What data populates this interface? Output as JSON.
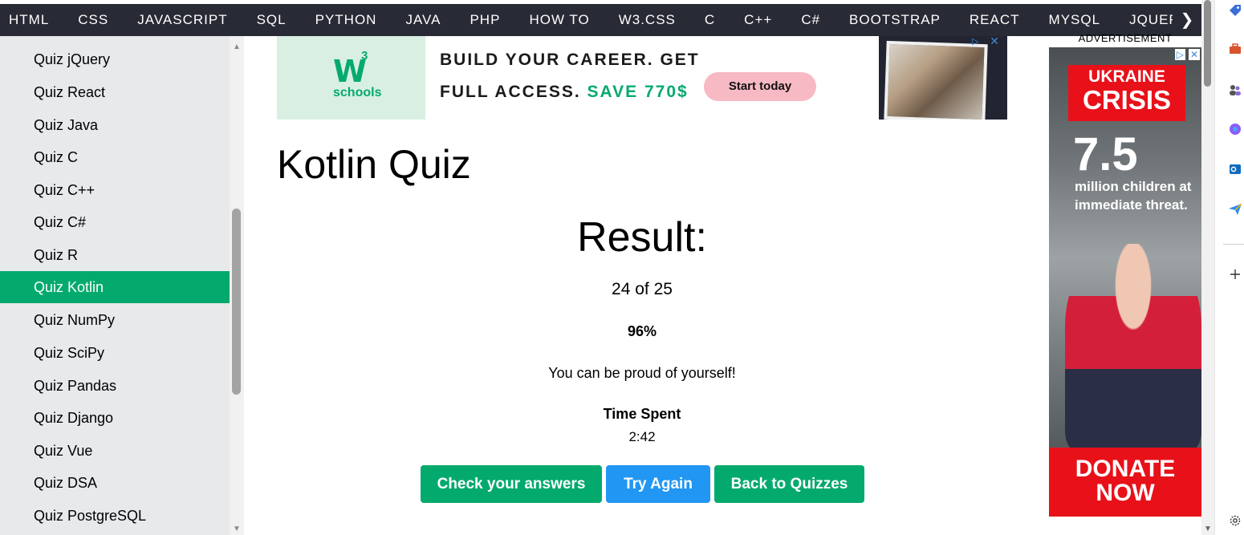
{
  "topnav": {
    "items": [
      "HTML",
      "CSS",
      "JAVASCRIPT",
      "SQL",
      "PYTHON",
      "JAVA",
      "PHP",
      "HOW TO",
      "W3.CSS",
      "C",
      "C++",
      "C#",
      "BOOTSTRAP",
      "REACT",
      "MYSQL",
      "JQUERY"
    ],
    "next_glyph": "❯"
  },
  "sidebar": {
    "items": [
      {
        "label": "Quiz jQuery"
      },
      {
        "label": "Quiz React"
      },
      {
        "label": "Quiz Java"
      },
      {
        "label": "Quiz C"
      },
      {
        "label": "Quiz C++"
      },
      {
        "label": "Quiz C#"
      },
      {
        "label": "Quiz R"
      },
      {
        "label": "Quiz Kotlin",
        "active": true
      },
      {
        "label": "Quiz NumPy"
      },
      {
        "label": "Quiz SciPy"
      },
      {
        "label": "Quiz Pandas"
      },
      {
        "label": "Quiz Django"
      },
      {
        "label": "Quiz Vue"
      },
      {
        "label": "Quiz DSA"
      },
      {
        "label": "Quiz PostgreSQL"
      }
    ]
  },
  "ad_banner": {
    "w3": "W",
    "w3_sup": "3",
    "schools": "schools",
    "line1": "BUILD YOUR CAREER. GET",
    "line2_prefix": "FULL ACCESS.",
    "line2_save": "SAVE 770$",
    "cta": "Start today"
  },
  "main": {
    "title": "Kotlin Quiz",
    "result_heading": "Result:",
    "score": "24 of 25",
    "percent": "96%",
    "message": "You can be proud of yourself!",
    "time_label": "Time Spent",
    "time_value": "2:42",
    "buttons": {
      "check": "Check your answers",
      "again": "Try Again",
      "back": "Back to Quizzes"
    }
  },
  "right_ad": {
    "label": "ADVERTISEMENT",
    "crisis_l1": "UKRAINE",
    "crisis_l2": "CRISIS",
    "big_number": "7.5",
    "sub_text": "million children at immediate threat.",
    "donate_l1": "DONATE",
    "donate_l2": "NOW"
  },
  "colors": {
    "nav_bg": "#282a35",
    "sidebar_bg": "#e7e9eb",
    "active_green": "#04aa6d",
    "try_again_blue": "#2196f3",
    "unicef_red": "#e8111a"
  },
  "icons": {
    "scroll_up": "▲",
    "scroll_down": "▼",
    "ad_choices": "▷",
    "ad_close": "✕",
    "edge": [
      "tag-icon",
      "briefcase-icon",
      "people-icon",
      "copilot-icon",
      "outlook-icon",
      "send-icon",
      "plus-icon",
      "gear-icon"
    ]
  }
}
